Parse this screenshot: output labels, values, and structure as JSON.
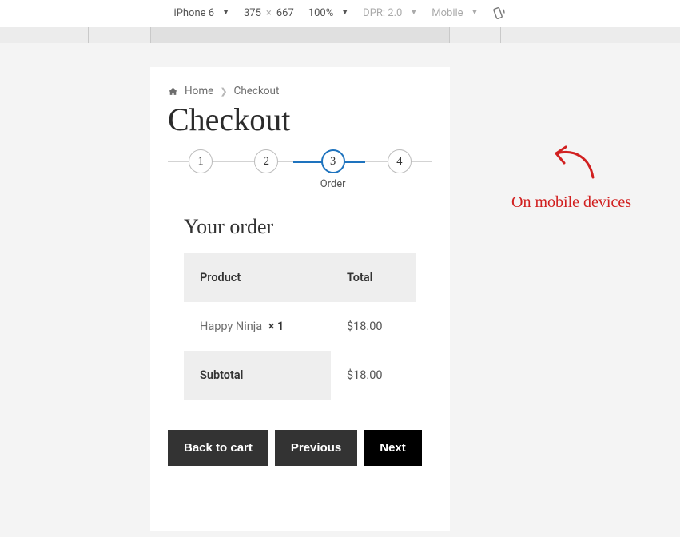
{
  "devtools": {
    "device": "iPhone 6",
    "width": "375",
    "height": "667",
    "dim_sep": "×",
    "zoom": "100%",
    "dpr": "DPR: 2.0",
    "throttle": "Mobile"
  },
  "breadcrumb": {
    "home": "Home",
    "current": "Checkout"
  },
  "page": {
    "title": "Checkout"
  },
  "steps": {
    "s1": "1",
    "s2": "2",
    "s3": "3",
    "s4": "4",
    "s3_label": "Order"
  },
  "order": {
    "heading": "Your order",
    "col_product": "Product",
    "col_total": "Total",
    "item_name": "Happy Ninja",
    "item_qty": "× 1",
    "item_total": "$18.00",
    "subtotal_label": "Subtotal",
    "subtotal_value": "$18.00"
  },
  "buttons": {
    "back": "Back to cart",
    "prev": "Previous",
    "next": "Next"
  },
  "overlay": {
    "text": "On mobile devices"
  }
}
